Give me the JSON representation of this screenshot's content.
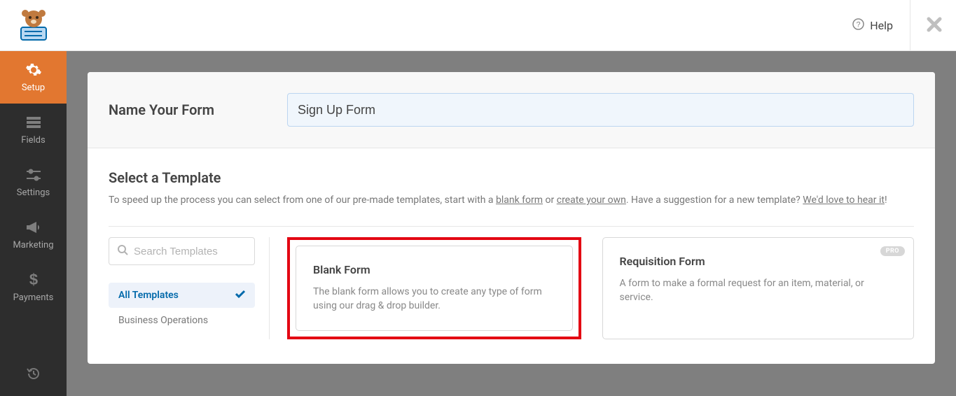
{
  "topbar": {
    "help_label": "Help"
  },
  "sidebar": {
    "items": [
      {
        "label": "Setup"
      },
      {
        "label": "Fields"
      },
      {
        "label": "Settings"
      },
      {
        "label": "Marketing"
      },
      {
        "label": "Payments"
      }
    ]
  },
  "name": {
    "label": "Name Your Form",
    "value": "Sign Up Form"
  },
  "template": {
    "heading": "Select a Template",
    "sub_1": "To speed up the process you can select from one of our pre-made templates, start with a ",
    "sub_link1": "blank form",
    "sub_2": " or ",
    "sub_link2": "create your own",
    "sub_3": ". Have a suggestion for a new template? ",
    "sub_link3": "We'd love to hear it",
    "sub_4": "!"
  },
  "search": {
    "placeholder": "Search Templates"
  },
  "categories": [
    {
      "label": "All Templates",
      "active": true
    },
    {
      "label": "Business Operations",
      "active": false
    }
  ],
  "cards": [
    {
      "title": "Blank Form",
      "desc": "The blank form allows you to create any type of form using our drag & drop builder.",
      "pro": false,
      "highlight": true
    },
    {
      "title": "Requisition Form",
      "desc": "A form to make a formal request for an item, material, or service.",
      "pro": true,
      "highlight": false,
      "badge": "PRO"
    }
  ]
}
